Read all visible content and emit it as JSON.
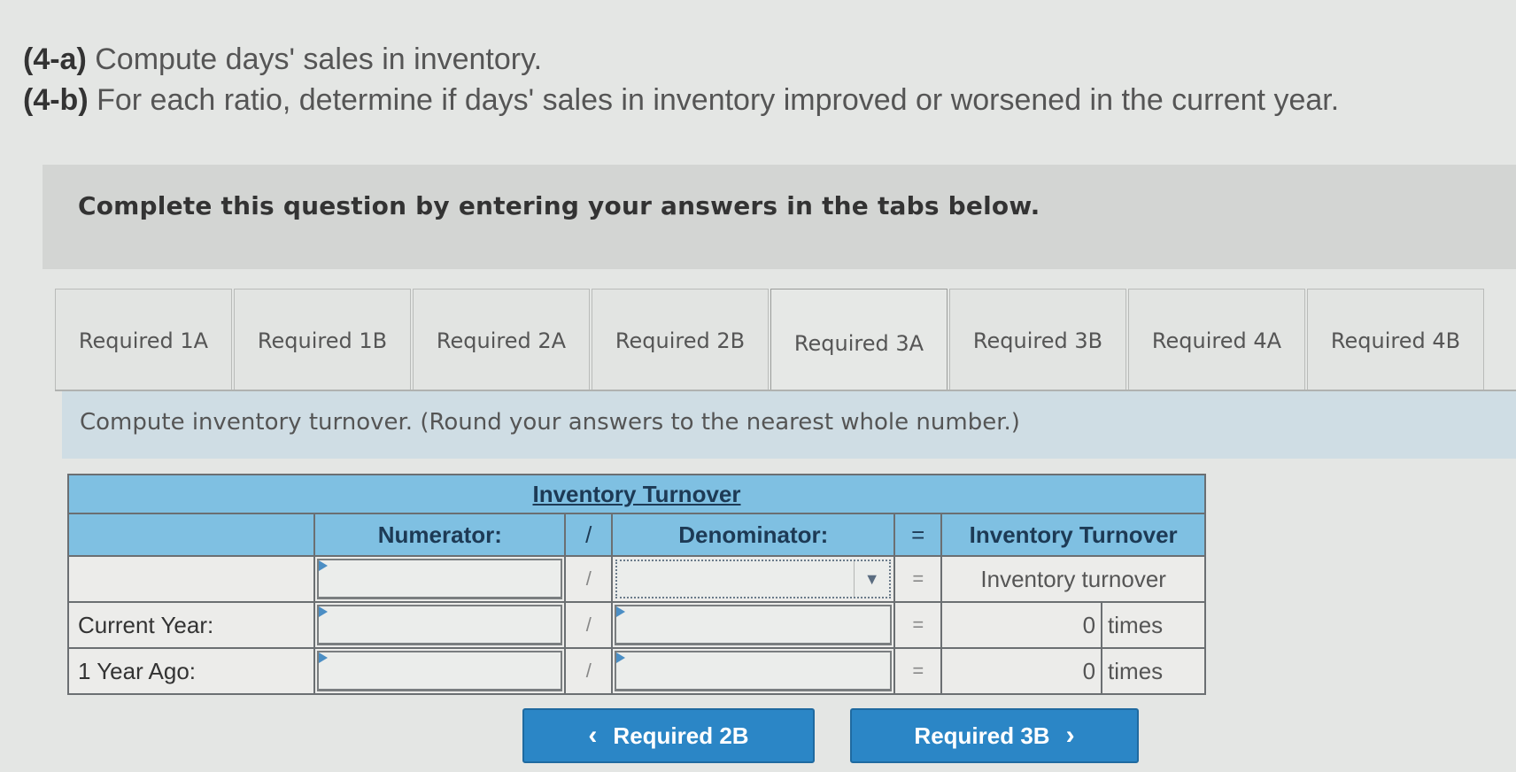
{
  "instructions": [
    {
      "tag": "(4-a)",
      "text": "Compute days' sales in inventory."
    },
    {
      "tag": "(4-b)",
      "text": "For each ratio, determine if days' sales in inventory improved or worsened in the current year."
    }
  ],
  "banner": {
    "text": "Complete this question by entering your answers in the tabs below."
  },
  "tabs": [
    {
      "label": "Required 1A",
      "active": false
    },
    {
      "label": "Required 1B",
      "active": false
    },
    {
      "label": "Required 2A",
      "active": false
    },
    {
      "label": "Required 2B",
      "active": false
    },
    {
      "label": "Required 3A",
      "active": true
    },
    {
      "label": "Required 3B",
      "active": false
    },
    {
      "label": "Required 4A",
      "active": false
    },
    {
      "label": "Required 4B",
      "active": false
    }
  ],
  "prompt": "Compute inventory turnover. (Round your answers to the nearest whole number.)",
  "table": {
    "title": "Inventory Turnover",
    "headers": {
      "numerator": "Numerator:",
      "divide": "/",
      "denominator": "Denominator:",
      "equals": "=",
      "result": "Inventory Turnover"
    },
    "formula_row": {
      "label": "",
      "numerator": "",
      "divide": "/",
      "denominator": "",
      "equals": "=",
      "result": "Inventory turnover"
    },
    "rows": [
      {
        "label": "Current Year:",
        "numerator": "",
        "divide": "/",
        "denominator": "",
        "equals": "=",
        "value": "0",
        "unit": "times"
      },
      {
        "label": "1 Year Ago:",
        "numerator": "",
        "divide": "/",
        "denominator": "",
        "equals": "=",
        "value": "0",
        "unit": "times"
      }
    ]
  },
  "nav": {
    "prev_label": "Required 2B",
    "prev_icon": "‹",
    "next_label": "Required 3B",
    "next_icon": "›"
  }
}
